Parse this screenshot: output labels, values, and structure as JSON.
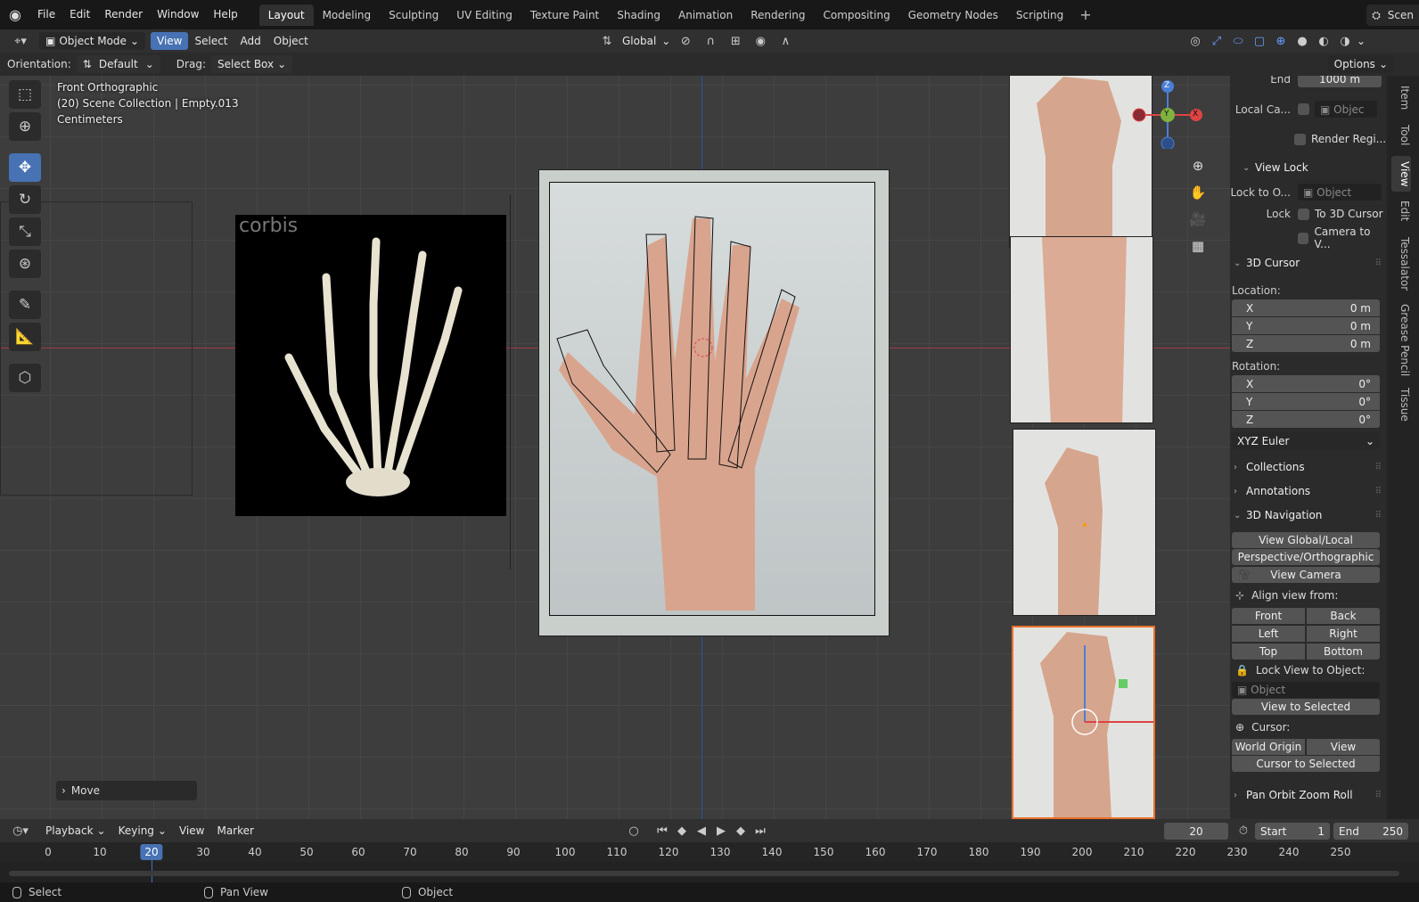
{
  "topbar": {
    "menus": [
      "File",
      "Edit",
      "Render",
      "Window",
      "Help"
    ],
    "workspaces": [
      "Layout",
      "Modeling",
      "Sculpting",
      "UV Editing",
      "Texture Paint",
      "Shading",
      "Animation",
      "Rendering",
      "Compositing",
      "Geometry Nodes",
      "Scripting"
    ],
    "active_workspace": "Layout",
    "add_tab": "+",
    "scene_label": "Scen"
  },
  "header": {
    "mode": "Object Mode",
    "menus": [
      "View",
      "Select",
      "Add",
      "Object"
    ],
    "active_menu": "View",
    "transform_orientation": "Global"
  },
  "toolsettings": {
    "orientation_label": "Orientation:",
    "orientation_value": "Default",
    "drag_label": "Drag:",
    "drag_value": "Select Box",
    "options": "Options"
  },
  "viewport": {
    "view_name": "Front Orthographic",
    "collection_info": "(20) Scene Collection | Empty.013",
    "units": "Centimeters",
    "watermark": "corbis",
    "last_operator": "Move",
    "gizmo": {
      "z": "Z",
      "y": "Y",
      "x": "X"
    },
    "colors": {
      "x_axis": "#a23a45",
      "z_axis": "#2b52a5",
      "active_outline": "#e8702a"
    }
  },
  "sidebar": {
    "tabs": [
      "Item",
      "Tool",
      "View",
      "Edit",
      "Tessalator",
      "Grease Pencil",
      "Tissue"
    ],
    "active_tab": "View",
    "end_label": "End",
    "end_value": "1000 m",
    "local_camera_label": "Local Ca...",
    "local_camera_placeholder": "Objec",
    "render_region": "Render Regi...",
    "view_lock": {
      "title": "View Lock",
      "lock_to_label": "Lock to O...",
      "lock_to_placeholder": "Object",
      "lock_label": "Lock",
      "to_cursor": "To 3D Cursor",
      "camera_to_view": "Camera to V..."
    },
    "cursor": {
      "title": "3D Cursor",
      "location_label": "Location:",
      "location": [
        {
          "axis": "X",
          "value": "0 m"
        },
        {
          "axis": "Y",
          "value": "0 m"
        },
        {
          "axis": "Z",
          "value": "0 m"
        }
      ],
      "rotation_label": "Rotation:",
      "rotation": [
        {
          "axis": "X",
          "value": "0°"
        },
        {
          "axis": "Y",
          "value": "0°"
        },
        {
          "axis": "Z",
          "value": "0°"
        }
      ],
      "rotation_mode": "XYZ Euler"
    },
    "collections": "Collections",
    "annotations": "Annotations",
    "navigation": {
      "title": "3D Navigation",
      "view_global_local": "View Global/Local",
      "persp_ortho": "Perspective/Orthographic",
      "view_camera": "View Camera",
      "align_label": "Align view from:",
      "front": "Front",
      "back": "Back",
      "left": "Left",
      "right": "Right",
      "top": "Top",
      "bottom": "Bottom",
      "lock_view_label": "Lock View to Object:",
      "lock_view_placeholder": "Object",
      "view_selected": "View to Selected",
      "cursor_label": "Cursor:",
      "world_origin": "World Origin",
      "view": "View",
      "cursor_to_selected": "Cursor to Selected"
    },
    "pan_orbit": "Pan Orbit Zoom Roll"
  },
  "timeline": {
    "menus": [
      "Playback",
      "Keying",
      "View",
      "Marker"
    ],
    "current_frame": "20",
    "start_label": "Start",
    "start_value": "1",
    "end_label": "End",
    "end_value": "250",
    "ticks": [
      "0",
      "10",
      "20",
      "30",
      "40",
      "50",
      "60",
      "70",
      "80",
      "90",
      "100",
      "110",
      "120",
      "130",
      "140",
      "150",
      "160",
      "170",
      "180",
      "190",
      "200",
      "210",
      "220",
      "230",
      "240",
      "250"
    ]
  },
  "statusbar": {
    "items": [
      "Select",
      "Pan View",
      "Object"
    ]
  }
}
